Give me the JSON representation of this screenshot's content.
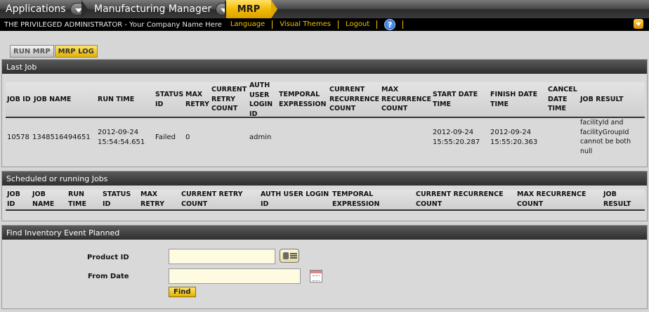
{
  "header": {
    "crumbs": [
      {
        "label": "Applications"
      },
      {
        "label": "Manufacturing Manager"
      },
      {
        "label": "MRP"
      }
    ],
    "user_text": "THE PRIVILEGED ADMINISTRATOR - Your Company Name Here",
    "links": [
      "Language",
      "Visual Themes",
      "Logout"
    ],
    "help_glyph": "?",
    "accent_color": "#f2c200"
  },
  "tabs": {
    "run": "RUN MRP",
    "log": "MRP LOG",
    "active": "MRP LOG"
  },
  "last_job": {
    "title": "Last Job",
    "columns": [
      "JOB ID",
      "JOB NAME",
      "RUN TIME",
      "STATUS ID",
      "MAX RETRY",
      "CURRENT RETRY COUNT",
      "AUTH USER LOGIN ID",
      "TEMPORAL EXPRESSION",
      "CURRENT RECURRENCE COUNT",
      "MAX RECURRENCE COUNT",
      "START DATE TIME",
      "FINISH DATE TIME",
      "CANCEL DATE TIME",
      "JOB RESULT"
    ],
    "rows": [
      {
        "job_id": "10578",
        "job_name": "1348516494651",
        "run_time": "2012-09-24 15:54:54.651",
        "status_id": "Failed",
        "max_retry": "0",
        "current_retry_count": "",
        "auth_user": "admin",
        "temporal_expression": "",
        "current_recurrence": "",
        "max_recurrence": "",
        "start_date": "2012-09-24 15:55:20.287",
        "finish_date": "2012-09-24 15:55:20.363",
        "cancel_date": "",
        "job_result": "facilityId and facilityGroupId cannot be both null"
      }
    ]
  },
  "scheduled": {
    "title": "Scheduled or running Jobs",
    "columns": [
      "JOB ID",
      "JOB NAME",
      "RUN TIME",
      "STATUS ID",
      "MAX RETRY",
      "CURRENT RETRY COUNT",
      "AUTH USER LOGIN ID",
      "TEMPORAL EXPRESSION",
      "CURRENT RECURRENCE COUNT",
      "MAX RECURRENCE COUNT",
      "JOB RESULT"
    ]
  },
  "find": {
    "title": "Find Inventory Event Planned",
    "product_label": "Product ID",
    "product_value": "",
    "from_date_label": "From Date",
    "from_date_value": "",
    "button": "Find"
  }
}
